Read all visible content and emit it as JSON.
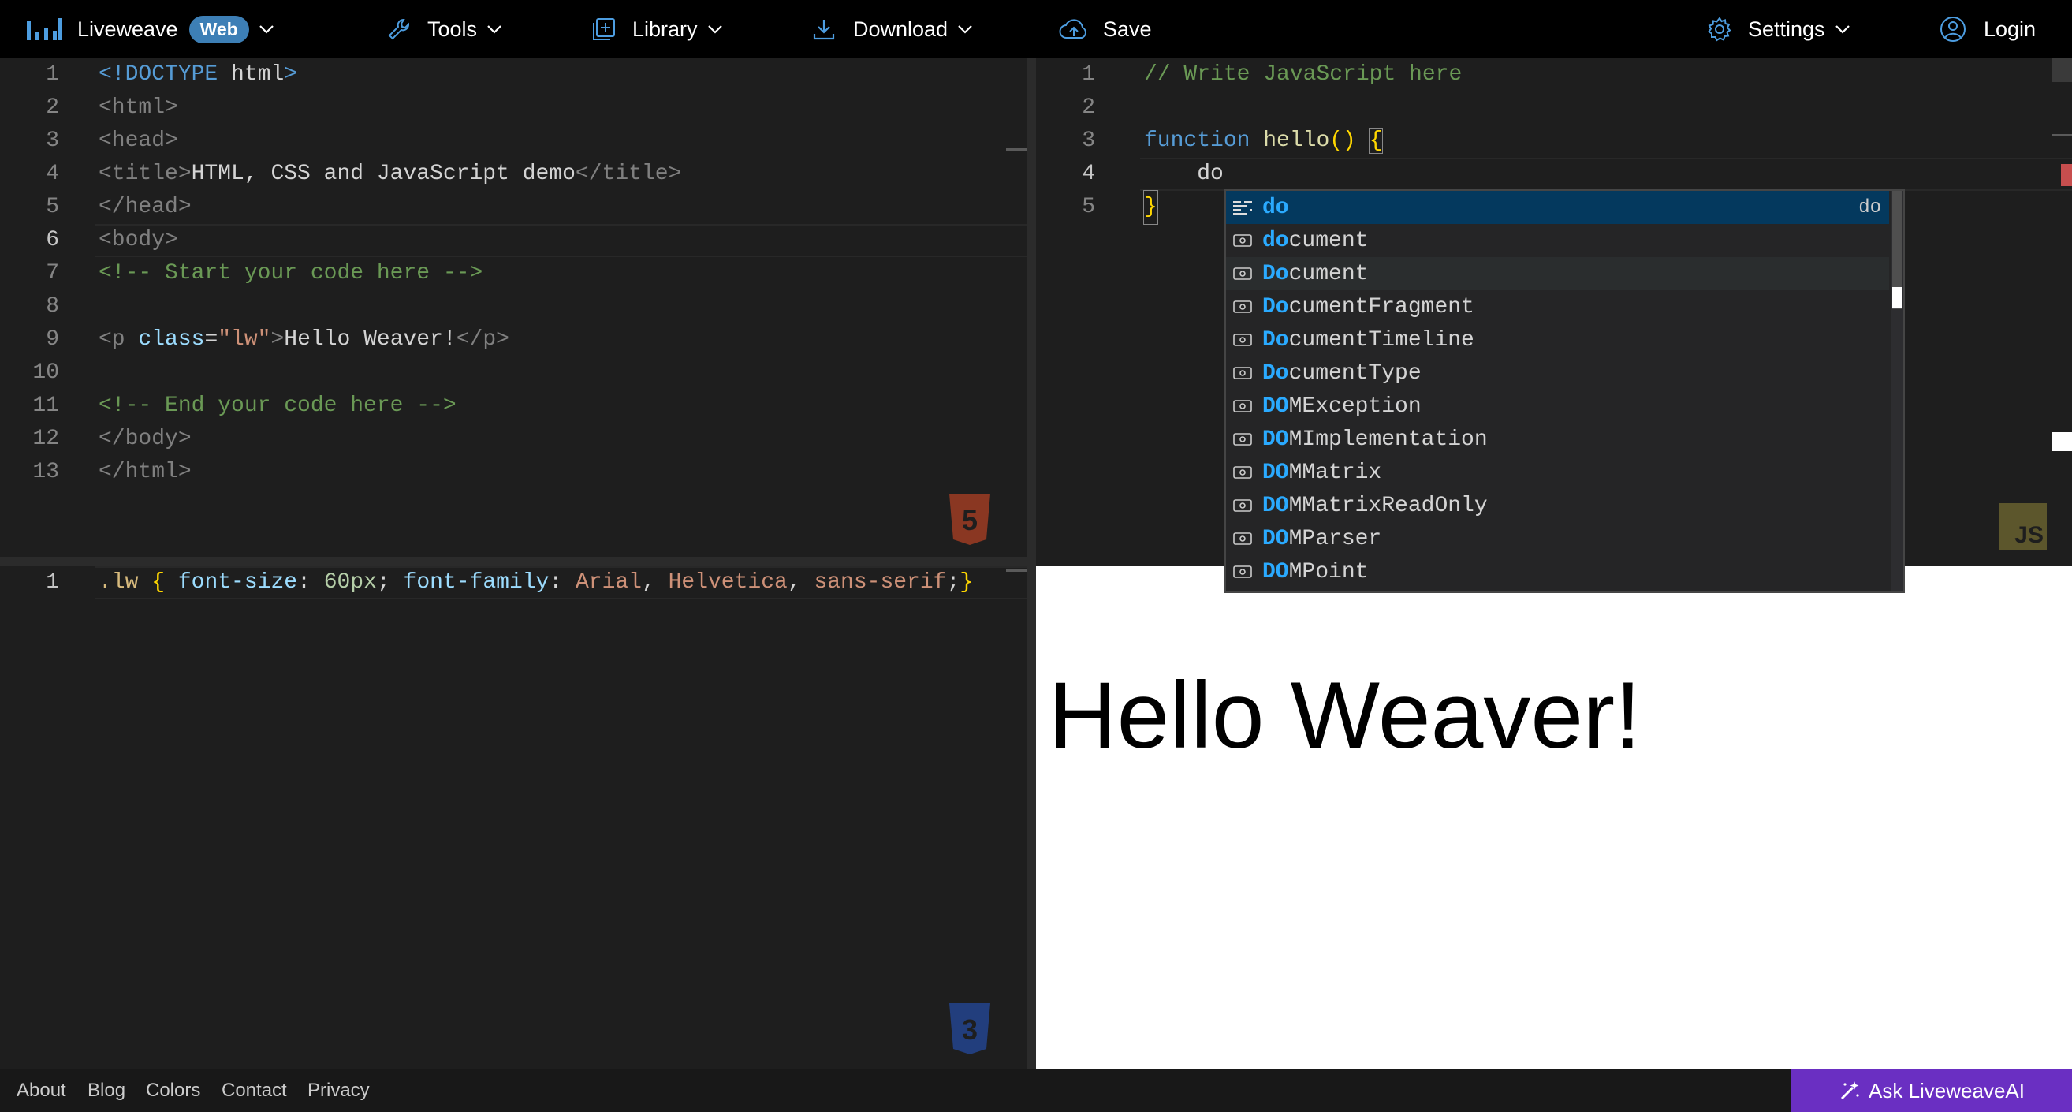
{
  "header": {
    "brand": "Liveweave",
    "badge": "Web",
    "tools": "Tools",
    "library": "Library",
    "download": "Download",
    "save": "Save",
    "settings": "Settings",
    "login": "Login"
  },
  "html_editor": {
    "line_numbers": [
      "1",
      "2",
      "3",
      "4",
      "5",
      "6",
      "7",
      "8",
      "9",
      "10",
      "11",
      "12",
      "13"
    ],
    "lines": {
      "l1_tag_open": "<!DOCTYPE ",
      "l1_name": "html",
      "l1_close": ">",
      "l2": "<html>",
      "l3": "<head>",
      "l4_open": "<title>",
      "l4_text": "HTML, CSS and JavaScript demo",
      "l4_close": "</title>",
      "l5": "</head>",
      "l6": "<body>",
      "l7": "<!-- Start your code here -->",
      "l9_open": "<p ",
      "l9_attr": "class",
      "l9_eq": "=",
      "l9_str": "\"lw\"",
      "l9_gt": ">",
      "l9_text": "Hello Weaver!",
      "l9_close": "</p>",
      "l11": "<!-- End your code here -->",
      "l12": "</body>",
      "l13": "</html>"
    },
    "badge": "5"
  },
  "css_editor": {
    "line_numbers": [
      "1"
    ],
    "line": {
      "selector": ".lw",
      "brace_open": " { ",
      "prop1": "font-size",
      "colon1": ": ",
      "val1": "60px",
      "semi1": "; ",
      "prop2": "font-family",
      "colon2": ": ",
      "val2a": "Arial",
      "comma1": ", ",
      "val2b": "Helvetica",
      "comma2": ", ",
      "val2c": "sans-serif",
      "semi2": ";",
      "brace_close": "}"
    },
    "badge": "3"
  },
  "js_editor": {
    "line_numbers": [
      "1",
      "2",
      "3",
      "4",
      "5"
    ],
    "lines": {
      "l1": "// Write JavaScript here",
      "l3_kw": "function",
      "l3_fn": "hello",
      "l3_paren": "()",
      "l3_brace": "{",
      "l4": "    do",
      "l5": "}"
    },
    "badge": "JS"
  },
  "autocomplete": {
    "items": [
      {
        "match": "do",
        "rest": "",
        "detail": "do"
      },
      {
        "match": "do",
        "rest": "cument"
      },
      {
        "match": "Do",
        "rest": "cument"
      },
      {
        "match": "Do",
        "rest": "cumentFragment"
      },
      {
        "match": "Do",
        "rest": "cumentTimeline"
      },
      {
        "match": "Do",
        "rest": "cumentType"
      },
      {
        "match": "DO",
        "rest": "MException"
      },
      {
        "match": "DO",
        "rest": "MImplementation"
      },
      {
        "match": "DO",
        "rest": "MMatrix"
      },
      {
        "match": "DO",
        "rest": "MMatrixReadOnly"
      },
      {
        "match": "DO",
        "rest": "MParser"
      },
      {
        "match": "DO",
        "rest": "MPoint"
      }
    ]
  },
  "preview": {
    "text": "Hello Weaver!"
  },
  "footer": {
    "links": [
      "About",
      "Blog",
      "Colors",
      "Contact",
      "Privacy"
    ],
    "ask_ai": "Ask LiveweaveAI"
  },
  "colors": {
    "accent": "#3d7fb6",
    "ai_button": "#6a2fc2",
    "html_badge": "#e44d26",
    "css_badge": "#2965f1",
    "js_badge": "#f0db4f"
  }
}
